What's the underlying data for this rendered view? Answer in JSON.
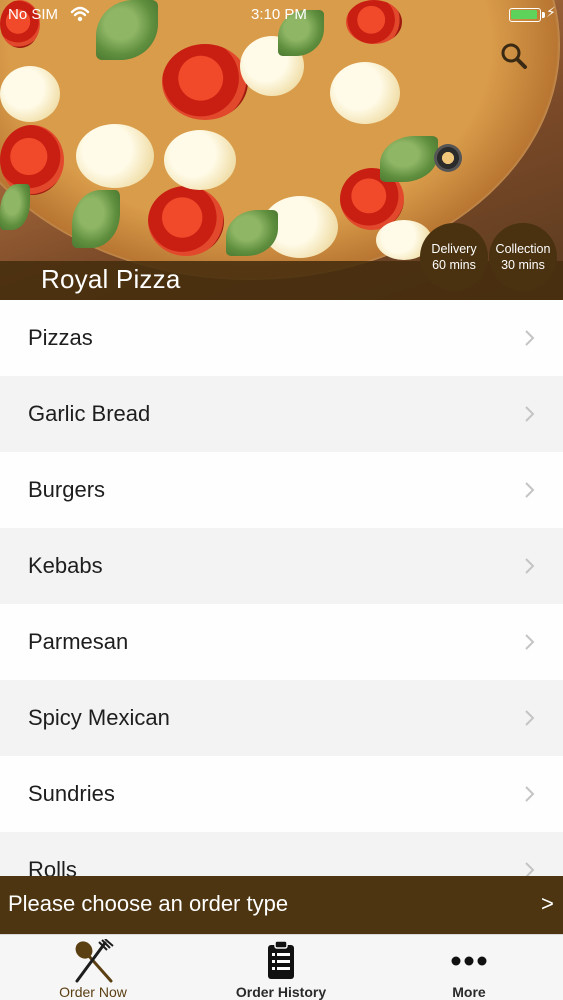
{
  "status_bar": {
    "carrier": "No SIM",
    "time": "3:10 PM"
  },
  "restaurant": {
    "name": "Royal Pizza"
  },
  "badges": {
    "delivery": {
      "title": "Delivery",
      "time": "60 mins"
    },
    "collection": {
      "title": "Collection",
      "time": "30 mins"
    }
  },
  "menu": {
    "categories": [
      "Pizzas",
      "Garlic Bread",
      "Burgers",
      "Kebabs",
      "Parmesan",
      "Spicy Mexican",
      "Sundries",
      "Rolls"
    ]
  },
  "order_bar": {
    "text": "Please choose an order type",
    "arrow": ">"
  },
  "tabs": [
    {
      "label": "Order Now",
      "icon": "fork-knife-icon",
      "active": true
    },
    {
      "label": "Order History",
      "icon": "clipboard-icon",
      "active": false
    },
    {
      "label": "More",
      "icon": "more-dots-icon",
      "active": false
    }
  ],
  "colors": {
    "brand_brown": "#4c3510",
    "title_bar": "#462d0e",
    "battery_green": "#5dd35b"
  }
}
